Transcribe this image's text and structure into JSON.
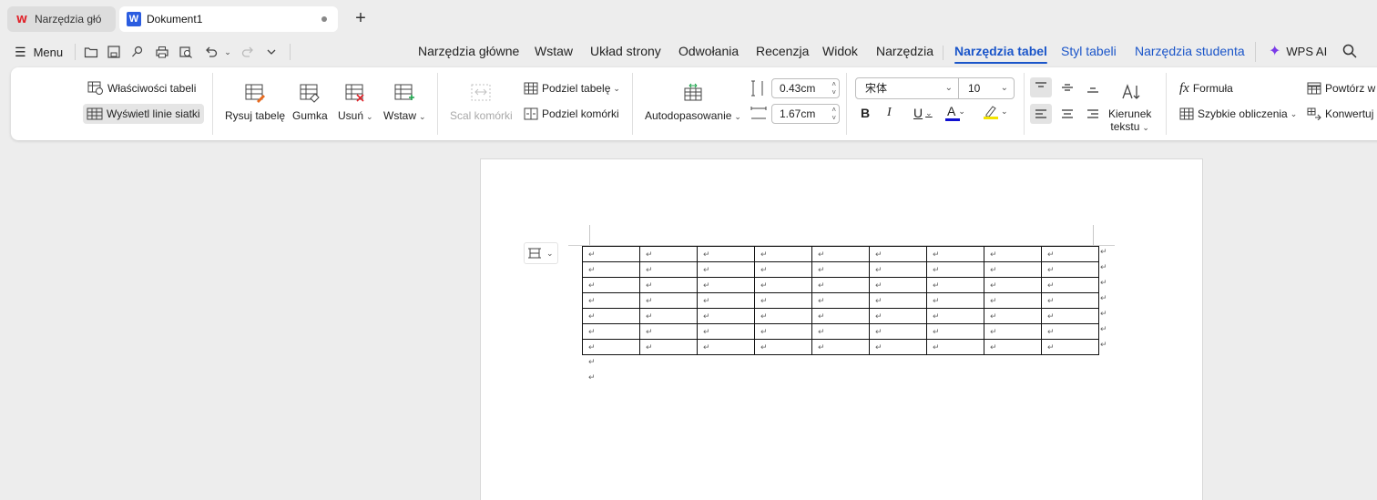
{
  "tabs": [
    {
      "label": "Narzędzia głó"
    },
    {
      "label": "Dokument1"
    }
  ],
  "menu": {
    "label": "Menu"
  },
  "ribbon_tabs": {
    "home": "Narzędzia główne",
    "insert": "Wstaw",
    "layout": "Układ strony",
    "references": "Odwołania",
    "review": "Recenzja",
    "view": "Widok",
    "tools": "Narzędzia",
    "table_tools": "Narzędzia tabel",
    "table_style": "Styl tabeli",
    "student_tools": "Narzędzia studenta",
    "wps_ai": "WPS AI"
  },
  "ribbon": {
    "table_properties": "Właściwości tabeli",
    "show_gridlines": "Wyświetl linie siatki",
    "draw_table": "Rysuj tabelę",
    "eraser": "Gumka",
    "delete": "Usuń",
    "insert": "Wstaw",
    "merge_cells": "Scal komórki",
    "split_table": "Podziel tabelę",
    "split_cells": "Podziel komórki",
    "autofit": "Autodopasowanie",
    "row_height": "0.43cm",
    "col_width": "1.67cm",
    "font_name": "宋体",
    "font_size": "10",
    "bold": "B",
    "italic": "I",
    "underline": "U",
    "font_color_letter": "A",
    "text_direction_line1": "Kierunek",
    "text_direction_line2": "tekstu",
    "formula": "Formuła",
    "quick_calc": "Szybkie obliczenia",
    "repeat_header": "Powtórz w",
    "convert": "Konwertuj"
  },
  "document": {
    "rows": 7,
    "cols": 9,
    "cell_mark": "↵",
    "empty_paragraphs": 2
  },
  "colors": {
    "accent": "#1a55c9",
    "font_color": "#1010d0",
    "highlight": "#f4e400",
    "wps_logo": "#e0242b",
    "ai": "#7a3be8"
  }
}
